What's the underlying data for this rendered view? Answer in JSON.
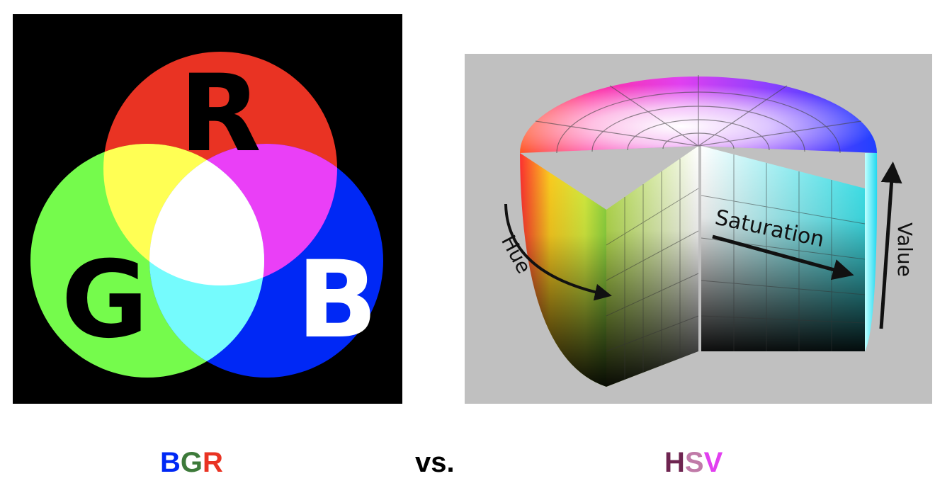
{
  "rgb_diagram": {
    "labels": {
      "r": "R",
      "g": "G",
      "b": "B"
    },
    "colors": {
      "background": "#000000",
      "red": "#e93323",
      "green": "#75fb4c",
      "blue": "#0028f5",
      "yellow": "#ffff54",
      "magenta": "#ea3ff7",
      "cyan": "#75fbfd",
      "white": "#ffffff",
      "label_r": "#000000",
      "label_g": "#000000",
      "label_b": "#ffffff"
    }
  },
  "hsv_diagram": {
    "labels": {
      "hue": "Hue",
      "saturation": "Saturation",
      "value": "Value"
    },
    "colors": {
      "background": "#c0c0c0"
    }
  },
  "captions": {
    "left": {
      "letters": [
        {
          "char": "B",
          "color": "#0028f5"
        },
        {
          "char": "G",
          "color": "#3d7a3a"
        },
        {
          "char": "R",
          "color": "#e93323"
        }
      ]
    },
    "middle": "vs.",
    "right": {
      "letters": [
        {
          "char": "H",
          "color": "#6e2450"
        },
        {
          "char": "S",
          "color": "#c07aa8"
        },
        {
          "char": "V",
          "color": "#e23ff0"
        }
      ]
    }
  }
}
